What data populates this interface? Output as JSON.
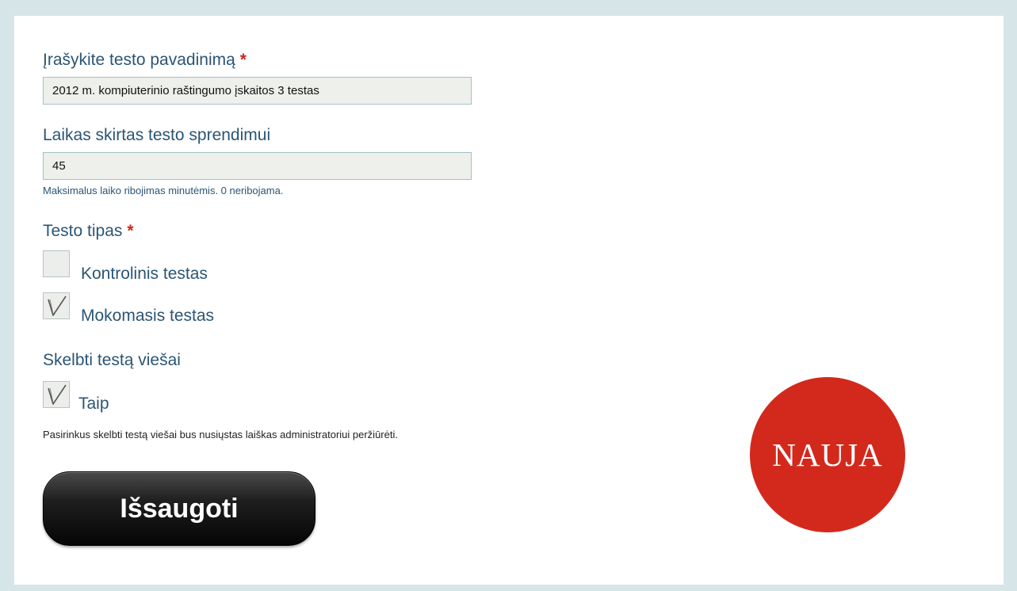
{
  "form": {
    "name_label": "Įrašykite testo pavadinimą",
    "name_required_mark": "*",
    "name_value": "2012 m. kompiuterinio raštingumo įskaitos 3 testas",
    "time_label": "Laikas skirtas testo sprendimui",
    "time_value": "45",
    "time_hint": "Maksimalus laiko ribojimas minutėmis. 0 neribojama.",
    "type_label": "Testo tipas",
    "type_required_mark": "*",
    "type_options": [
      {
        "label": "Kontrolinis testas",
        "checked": false
      },
      {
        "label": "Mokomasis testas",
        "checked": true
      }
    ],
    "public_label": "Skelbti testą viešai",
    "public_option": {
      "label": "Taip",
      "checked": true
    },
    "public_hint": "Pasirinkus skelbti testą viešai bus nusiųstas laiškas administratoriui peržiūrėti.",
    "save_label": "Išsaugoti"
  },
  "badge": {
    "text": "NAUJA",
    "color": "#d3291c"
  },
  "colors": {
    "label": "#2b5574",
    "required": "#d0261b",
    "button": "#111111"
  }
}
